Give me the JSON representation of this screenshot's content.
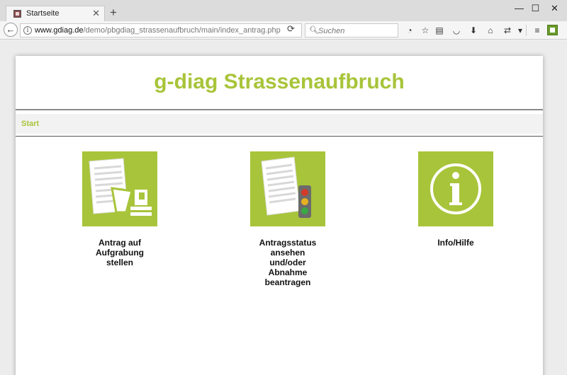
{
  "browser": {
    "tab_title": "Startseite",
    "tab_close": "✕",
    "new_tab": "+",
    "url_domain": "www.gdiag.de",
    "url_path": "/demo/pbgdiag_strassenaufbruch/main/index_antrag.php",
    "search_placeholder": "Suchen",
    "window_controls": [
      "—",
      "☐",
      "✕"
    ]
  },
  "page": {
    "site_title": "g-diag Strassenaufbruch",
    "breadcrumb": "Start",
    "tiles": [
      {
        "label": "Antrag auf Aufgrabung stellen",
        "icon": "document-excavator-icon"
      },
      {
        "label": "Antragsstatus ansehen und/oder Abnahme beantragen",
        "icon": "document-traffic-light-icon"
      },
      {
        "label": "Info/Hilfe",
        "icon": "info-icon"
      }
    ]
  },
  "colors": {
    "brand_green": "#a8c43a",
    "traffic_red": "#d43a2a",
    "traffic_yellow": "#e8b020",
    "traffic_green": "#3aa845"
  }
}
